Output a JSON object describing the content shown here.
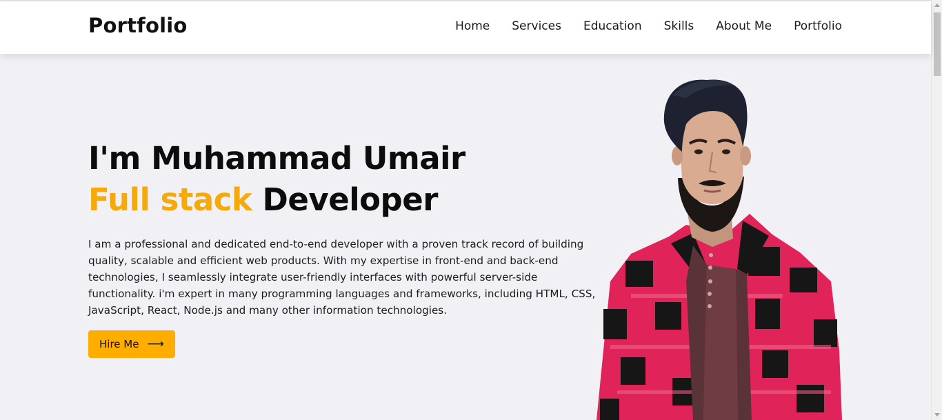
{
  "header": {
    "brand": "Portfolio",
    "nav": [
      {
        "label": "Home"
      },
      {
        "label": "Services"
      },
      {
        "label": "Education"
      },
      {
        "label": "Skills"
      },
      {
        "label": "About Me"
      },
      {
        "label": "Portfolio"
      }
    ]
  },
  "hero": {
    "greeting": "I'm Muhammad Umair",
    "role_accent": "Full stack",
    "role_rest": " Developer",
    "description": "I am a professional and dedicated end-to-end developer with a proven track record of building quality, scalable and efficient web products. With my expertise in front-end and back-end technologies, I seamlessly integrate user-friendly interfaces with powerful server-side functionality. i'm expert in many programming languages and frameworks, including HTML, CSS, JavaScript, React, Node.js and many other information technologies.",
    "cta_label": "Hire Me",
    "cta_icon": "arrow-right-icon"
  },
  "colors": {
    "accent": "#f5a90a",
    "button": "#ffad00",
    "background": "#f1f0f5",
    "jacket_red": "#e0245a",
    "jacket_black": "#161616"
  }
}
